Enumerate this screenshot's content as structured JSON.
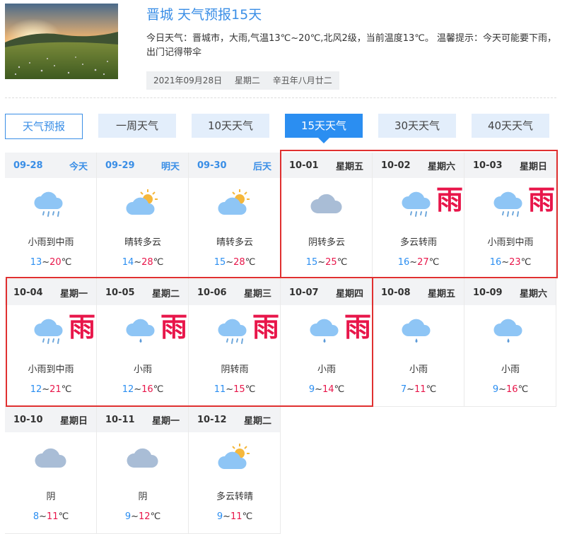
{
  "header": {
    "title": "晋城 天气预报15天",
    "description": "今日天气：晋城市，大雨,气温13℃~20℃,北风2级，当前温度13℃。 温馨提示：今天可能要下雨，出门记得带伞",
    "date": "2021年09月28日",
    "weekday": "星期二",
    "lunar": "辛丑年八月廿二"
  },
  "tabs": [
    {
      "label": "天气预报",
      "state": "outline"
    },
    {
      "label": "一周天气",
      "state": "normal"
    },
    {
      "label": "10天天气",
      "state": "normal"
    },
    {
      "label": "15天天气",
      "state": "active"
    },
    {
      "label": "30天天气",
      "state": "normal"
    },
    {
      "label": "40天天气",
      "state": "normal"
    }
  ],
  "temp_unit": "℃",
  "temp_sep": "~",
  "rain_badge": "雨",
  "days": [
    {
      "date": "09-28",
      "label": "今天",
      "icon": "rain-icon",
      "condition": "小雨到中雨",
      "low": "13",
      "high": "20",
      "highlight_header": true,
      "badge": false
    },
    {
      "date": "09-29",
      "label": "明天",
      "icon": "sun-cloud-icon",
      "condition": "晴转多云",
      "low": "14",
      "high": "28",
      "highlight_header": true,
      "badge": false
    },
    {
      "date": "09-30",
      "label": "后天",
      "icon": "sun-cloud-icon",
      "condition": "晴转多云",
      "low": "15",
      "high": "28",
      "highlight_header": true,
      "badge": false
    },
    {
      "date": "10-01",
      "label": "星期五",
      "icon": "cloud-icon",
      "condition": "阴转多云",
      "low": "15",
      "high": "25",
      "highlight_header": false,
      "badge": false
    },
    {
      "date": "10-02",
      "label": "星期六",
      "icon": "rain-icon",
      "condition": "多云转雨",
      "low": "16",
      "high": "27",
      "highlight_header": false,
      "badge": true
    },
    {
      "date": "10-03",
      "label": "星期日",
      "icon": "rain-icon",
      "condition": "小雨到中雨",
      "low": "16",
      "high": "23",
      "highlight_header": false,
      "badge": true
    },
    {
      "date": "10-04",
      "label": "星期一",
      "icon": "rain-icon",
      "condition": "小雨到中雨",
      "low": "12",
      "high": "21",
      "highlight_header": false,
      "badge": true
    },
    {
      "date": "10-05",
      "label": "星期二",
      "icon": "light-rain-icon",
      "condition": "小雨",
      "low": "12",
      "high": "16",
      "highlight_header": false,
      "badge": true
    },
    {
      "date": "10-06",
      "label": "星期三",
      "icon": "rain-icon",
      "condition": "阴转雨",
      "low": "11",
      "high": "15",
      "highlight_header": false,
      "badge": true
    },
    {
      "date": "10-07",
      "label": "星期四",
      "icon": "light-rain-icon",
      "condition": "小雨",
      "low": "9",
      "high": "14",
      "highlight_header": false,
      "badge": true
    },
    {
      "date": "10-08",
      "label": "星期五",
      "icon": "light-rain-icon",
      "condition": "小雨",
      "low": "7",
      "high": "11",
      "highlight_header": false,
      "badge": false
    },
    {
      "date": "10-09",
      "label": "星期六",
      "icon": "light-rain-icon",
      "condition": "小雨",
      "low": "9",
      "high": "16",
      "highlight_header": false,
      "badge": false
    },
    {
      "date": "10-10",
      "label": "星期日",
      "icon": "cloud-icon",
      "condition": "阴",
      "low": "8",
      "high": "11",
      "highlight_header": false,
      "badge": false
    },
    {
      "date": "10-11",
      "label": "星期一",
      "icon": "cloud-icon",
      "condition": "阴",
      "low": "9",
      "high": "12",
      "highlight_header": false,
      "badge": false
    },
    {
      "date": "10-12",
      "label": "星期二",
      "icon": "sun-cloud-icon",
      "condition": "多云转晴",
      "low": "9",
      "high": "11",
      "highlight_header": false,
      "badge": false
    }
  ],
  "colors": {
    "accent": "#2b8ef1",
    "low_temp": "#2b8ef1",
    "high_temp": "#e8164a",
    "highlight_box": "#e03030",
    "cloud_grey": "#a9bdd6",
    "cloud_blue": "#8ec5f5",
    "sun": "#f5b73b"
  }
}
